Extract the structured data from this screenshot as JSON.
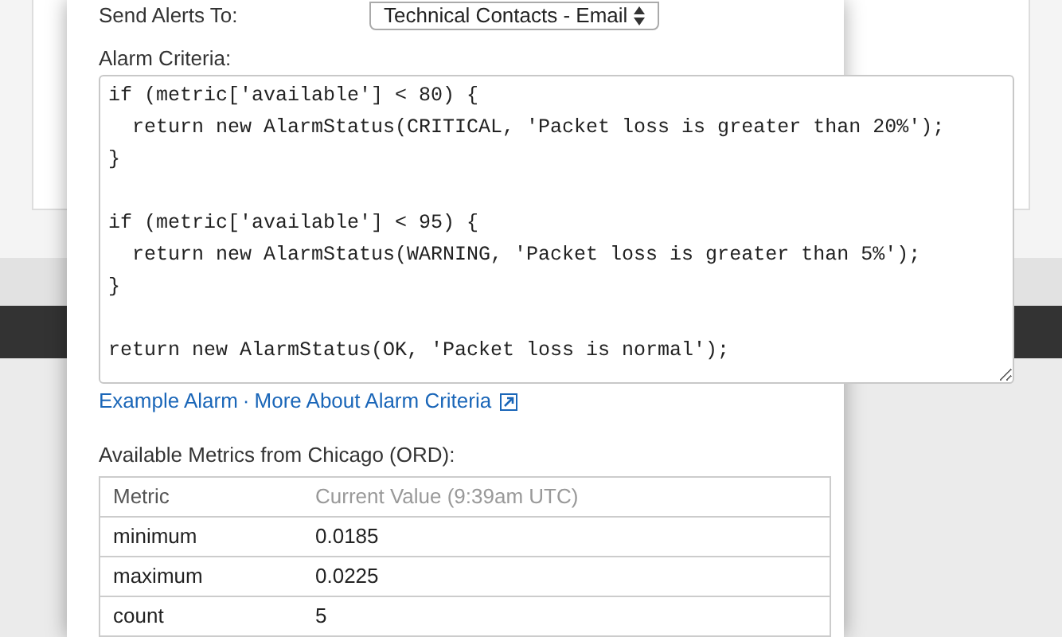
{
  "send_alerts": {
    "label": "Send Alerts To:",
    "value": "Technical Contacts - Email"
  },
  "alarm_criteria": {
    "label": "Alarm Criteria:",
    "code": "if (metric['available'] < 80) {\n  return new AlarmStatus(CRITICAL, 'Packet loss is greater than 20%');\n}\n\nif (metric['available'] < 95) {\n  return new AlarmStatus(WARNING, 'Packet loss is greater than 5%');\n}\n\nreturn new AlarmStatus(OK, 'Packet loss is normal');"
  },
  "links": [
    {
      "text": "Example Alarm",
      "external": false
    },
    {
      "text": "More About Alarm Criteria",
      "external": true
    }
  ],
  "link_separator": "·",
  "metrics": {
    "title": "Available Metrics from Chicago (ORD):",
    "columns": [
      "Metric",
      "Current Value (9:39am UTC)"
    ],
    "rows": [
      [
        "minimum",
        "0.0185"
      ],
      [
        "maximum",
        "0.0225"
      ],
      [
        "count",
        "5"
      ]
    ]
  }
}
